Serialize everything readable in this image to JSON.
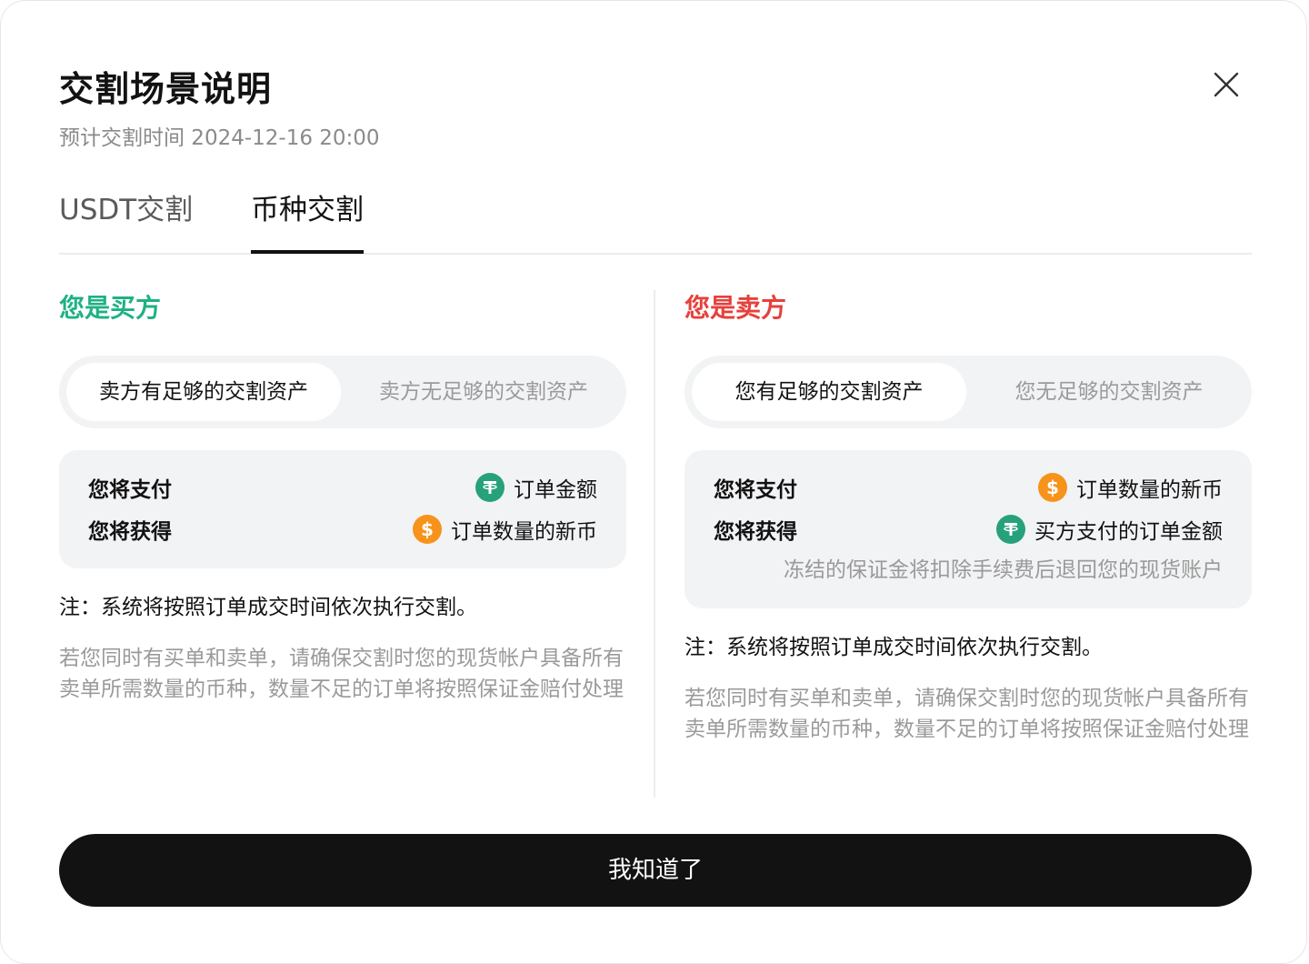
{
  "modal": {
    "title": "交割场景说明",
    "subtitle": "预计交割时间 2024-12-16 20:00",
    "close_icon": "close-icon"
  },
  "tabs": [
    {
      "label": "USDT交割",
      "active": false
    },
    {
      "label": "币种交割",
      "active": true
    }
  ],
  "buyer": {
    "role": "您是买方",
    "role_color": "#1fb184",
    "segments": [
      "卖方有足够的交割资产",
      "卖方无足够的交割资产"
    ],
    "pay_label": "您将支付",
    "pay_value": "订单金额",
    "pay_icon": "usdt-coin-icon",
    "receive_label": "您将获得",
    "receive_value": "订单数量的新币",
    "receive_icon": "dollar-coin-icon",
    "note": "注：系统将按照订单成交时间依次执行交割。",
    "tip": "若您同时有买单和卖单，请确保交割时您的现货帐户具备所有卖单所需数量的币种，数量不足的订单将按照保证金赔付处理"
  },
  "seller": {
    "role": "您是卖方",
    "role_color": "#e5413c",
    "segments": [
      "您有足够的交割资产",
      "您无足够的交割资产"
    ],
    "pay_label": "您将支付",
    "pay_value": "订单数量的新币",
    "pay_icon": "dollar-coin-icon",
    "receive_label": "您将获得",
    "receive_value": "买方支付的订单金额",
    "receive_icon": "usdt-coin-icon",
    "freeze_text": "冻结的保证金将扣除手续费后退回您的现货账户",
    "note": "注：系统将按照订单成交时间依次执行交割。",
    "tip": "若您同时有买单和卖单，请确保交割时您的现货帐户具备所有卖单所需数量的币种，数量不足的订单将按照保证金赔付处理"
  },
  "confirm_button": "我知道了"
}
